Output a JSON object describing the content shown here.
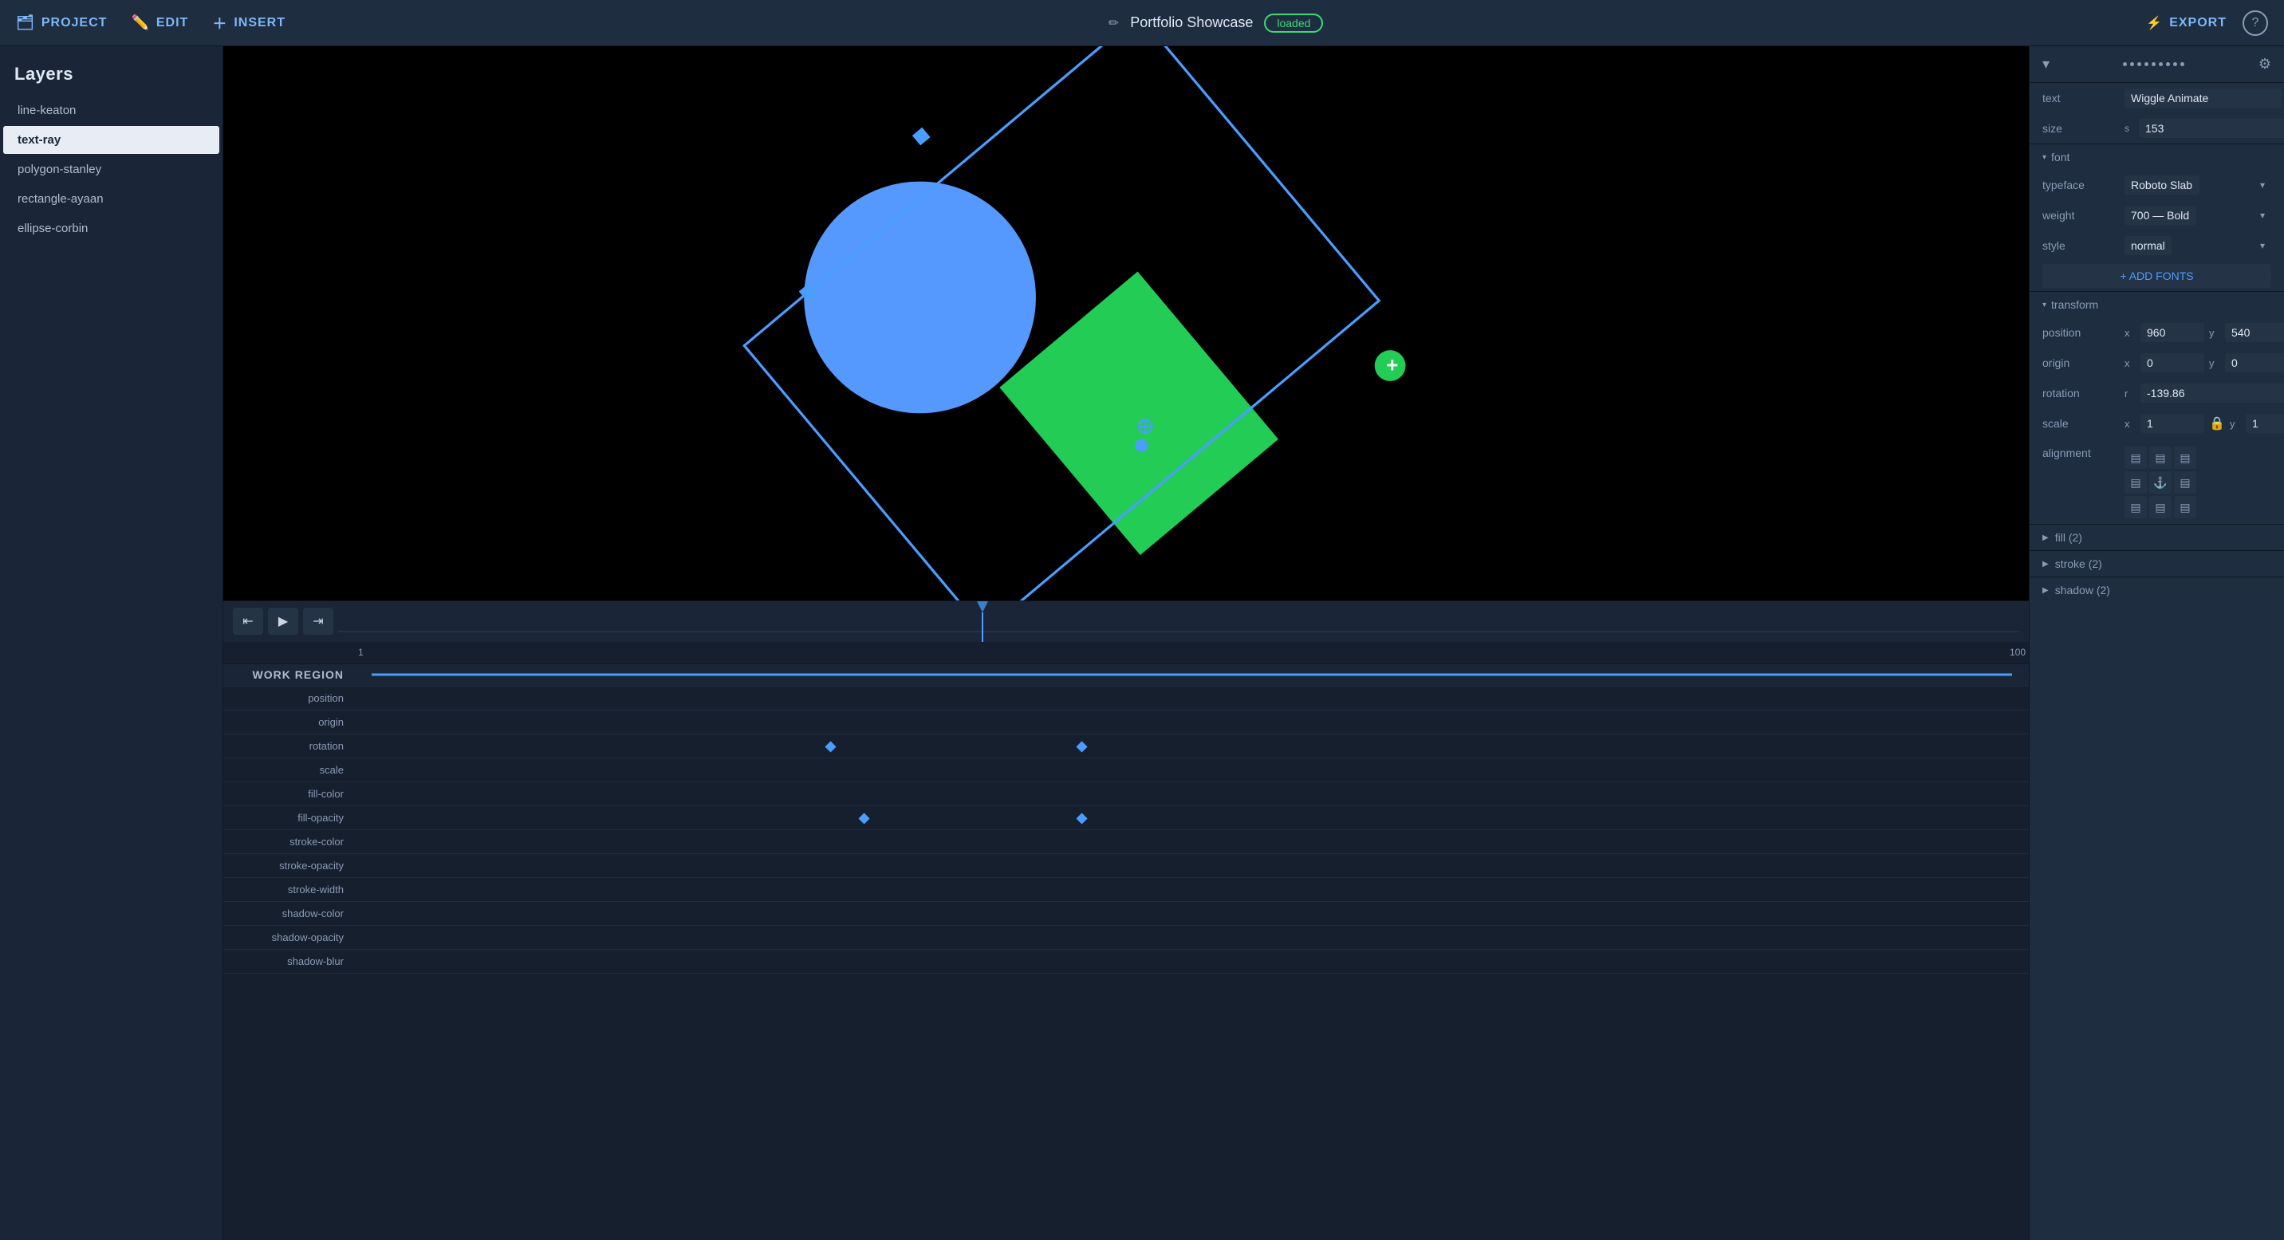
{
  "topbar": {
    "project_label": "PROJECT",
    "edit_label": "EDIT",
    "insert_label": "INSERT",
    "title": "Portfolio Showcase",
    "status_badge": "loaded",
    "export_label": "EXPORT",
    "help_label": "?"
  },
  "layers_panel": {
    "header": "Layers",
    "items": [
      {
        "id": "line-keaton",
        "label": "line-keaton",
        "active": false
      },
      {
        "id": "text-ray",
        "label": "text-ray",
        "active": true
      },
      {
        "id": "polygon-stanley",
        "label": "polygon-stanley",
        "active": false
      },
      {
        "id": "rectangle-ayaan",
        "label": "rectangle-ayaan",
        "active": false
      },
      {
        "id": "ellipse-corbin",
        "label": "ellipse-corbin",
        "active": false
      }
    ]
  },
  "right_panel": {
    "text_label": "text",
    "text_value": "Wiggle Animate",
    "size_label": "size",
    "size_prefix": "s",
    "size_value": "153",
    "font_section": "font",
    "typeface_label": "typeface",
    "typeface_value": "Roboto Slab",
    "weight_label": "weight",
    "weight_value": "700 — Bold",
    "style_label": "style",
    "style_value": "normal",
    "add_fonts_label": "+ ADD FONTS",
    "transform_section": "transform",
    "position_label": "position",
    "position_x": "960",
    "position_y": "540",
    "origin_label": "origin",
    "origin_x": "0",
    "origin_y": "0",
    "rotation_label": "rotation",
    "rotation_r": "-139.86",
    "scale_label": "scale",
    "scale_x": "1",
    "scale_y": "1",
    "alignment_label": "alignment",
    "fill_label": "fill (2)",
    "stroke_label": "stroke (2)",
    "shadow_label": "shadow (2)"
  },
  "timeline": {
    "work_region_label": "WORK REGION",
    "frame_start": "1",
    "frame_end": "100",
    "rows": [
      {
        "label": "position",
        "keyframes": []
      },
      {
        "label": "origin",
        "keyframes": []
      },
      {
        "label": "rotation",
        "keyframes": [
          {
            "pos": 28
          },
          {
            "pos": 43
          }
        ]
      },
      {
        "label": "scale",
        "keyframes": []
      },
      {
        "label": "fill-color",
        "keyframes": []
      },
      {
        "label": "fill-opacity",
        "keyframes": [
          {
            "pos": 30
          },
          {
            "pos": 43
          }
        ]
      },
      {
        "label": "stroke-color",
        "keyframes": []
      },
      {
        "label": "stroke-opacity",
        "keyframes": []
      },
      {
        "label": "stroke-width",
        "keyframes": []
      },
      {
        "label": "shadow-color",
        "keyframes": []
      },
      {
        "label": "shadow-opacity",
        "keyframes": []
      },
      {
        "label": "shadow-blur",
        "keyframes": []
      }
    ]
  }
}
